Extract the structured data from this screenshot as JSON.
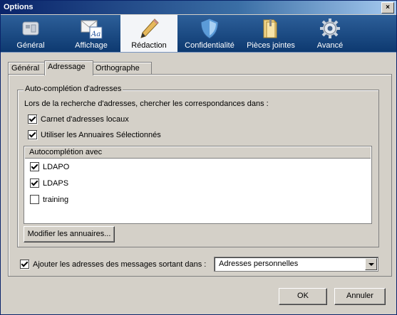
{
  "window": {
    "title": "Options",
    "close_glyph": "×"
  },
  "toolbar": {
    "items": [
      {
        "label": "Général",
        "icon": "general-settings-icon"
      },
      {
        "label": "Affichage",
        "icon": "display-letter-icon"
      },
      {
        "label": "Rédaction",
        "icon": "pencil-icon",
        "active": true
      },
      {
        "label": "Confidentialité",
        "icon": "shield-icon"
      },
      {
        "label": "Pièces jointes",
        "icon": "folder-icon"
      },
      {
        "label": "Avancé",
        "icon": "gear-icon"
      }
    ]
  },
  "tabs": [
    {
      "label": "Général"
    },
    {
      "label": "Adressage",
      "active": true
    },
    {
      "label": "Orthographe"
    }
  ],
  "autocomplete": {
    "group_title": "Auto-complétion d'adresses",
    "search_intro": "Lors de la recherche d'adresses, chercher les correspondances dans :",
    "local_book": {
      "label": "Carnet d'adresses locaux",
      "checked": true
    },
    "use_directories": {
      "label": "Utiliser les Annuaires Sélectionnés",
      "checked": true
    },
    "list_header": "Autocomplétion avec",
    "directories": [
      {
        "label": "LDAPO",
        "checked": true
      },
      {
        "label": "LDAPS",
        "checked": true
      },
      {
        "label": "training",
        "checked": false
      }
    ],
    "edit_button": "Modifier les annuaires..."
  },
  "outgoing": {
    "label": "Ajouter les adresses des messages sortant dans :",
    "checked": true,
    "selected": "Adresses personnelles"
  },
  "buttons": {
    "ok": "OK",
    "cancel": "Annuler"
  }
}
